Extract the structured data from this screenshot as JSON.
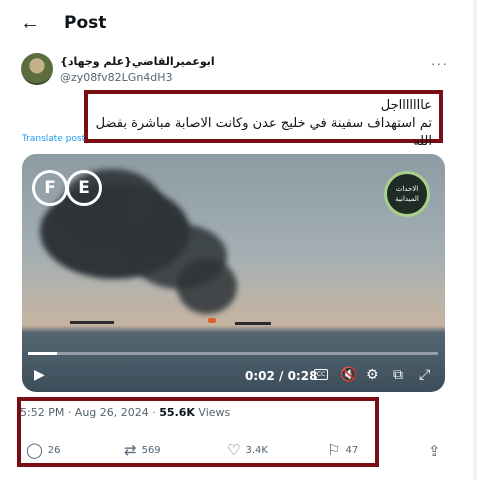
{
  "header": {
    "back_icon": "←",
    "title": "Post"
  },
  "author": {
    "name": "ابوعميرالقاضي{علم وجهاد}",
    "handle": "@zy08fv82LGn4dH3"
  },
  "more_icon": "···",
  "post": {
    "line1": "عاااااااجل",
    "line2": "تم استهداف سفينة في خليج عدن وكانت الاصابة مباشرة بفضل الله",
    "translate": "Translate post"
  },
  "video": {
    "logo_letters": [
      "F",
      "E"
    ],
    "badge_text": "الاحداث الميدانية",
    "time": "0:02 / 0:28",
    "cc_label": "CC",
    "progress": 0.07
  },
  "meta": {
    "time": "5:52 PM · Aug 26, 2024 · ",
    "views_count": "55.6K",
    "views_label": " Views"
  },
  "actions": {
    "replies": "26",
    "reposts": "569",
    "likes": "3.4K",
    "bookmarks": "47"
  },
  "colors": {
    "highlight_border": "#7a0c14",
    "link": "#1d9bf0",
    "muted": "#536471"
  }
}
